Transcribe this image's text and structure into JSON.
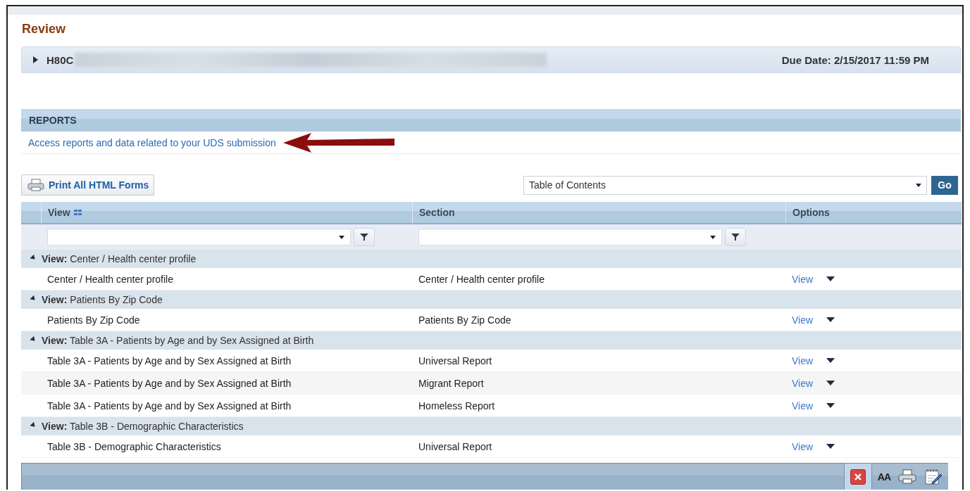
{
  "page": {
    "title": "Review"
  },
  "header": {
    "expanded": false,
    "code": "H80C",
    "due_date": "Due Date: 2/15/2017 11:59 PM"
  },
  "reports": {
    "title": "REPORTS",
    "link": "Access reports and data related to your UDS submission"
  },
  "toolbar": {
    "print_button": "Print All HTML Forms",
    "toc_select": {
      "value": "Table of Contents"
    },
    "go_button": "Go"
  },
  "grid": {
    "columns": [
      {
        "label": "View",
        "grouped": true
      },
      {
        "label": "Section",
        "grouped": false
      },
      {
        "label": "Options",
        "grouped": false
      }
    ],
    "groups": [
      {
        "prefix": "View:",
        "label": "Center / Health center profile",
        "expanded": true,
        "rows": [
          {
            "view": "Center / Health center profile",
            "section": "Center / Health center profile",
            "action": "View"
          }
        ]
      },
      {
        "prefix": "View:",
        "label": "Patients By Zip Code",
        "expanded": true,
        "rows": [
          {
            "view": "Patients By Zip Code",
            "section": "Patients By Zip Code",
            "action": "View"
          }
        ]
      },
      {
        "prefix": "View:",
        "label": "Table 3A - Patients by Age and by Sex Assigned at Birth",
        "expanded": true,
        "rows": [
          {
            "view": "Table 3A - Patients by Age and by Sex Assigned at Birth",
            "section": "Universal Report",
            "action": "View"
          },
          {
            "view": "Table 3A - Patients by Age and by Sex Assigned at Birth",
            "section": "Migrant Report",
            "action": "View"
          },
          {
            "view": "Table 3A - Patients by Age and by Sex Assigned at Birth",
            "section": "Homeless Report",
            "action": "View"
          }
        ]
      },
      {
        "prefix": "View:",
        "label": "Table 3B - Demographic Characteristics",
        "expanded": true,
        "rows": [
          {
            "view": "Table 3B - Demographic Characteristics",
            "section": "Universal Report",
            "action": "View"
          }
        ]
      }
    ]
  },
  "bottom_bar": {
    "text_size_label": "AA"
  }
}
